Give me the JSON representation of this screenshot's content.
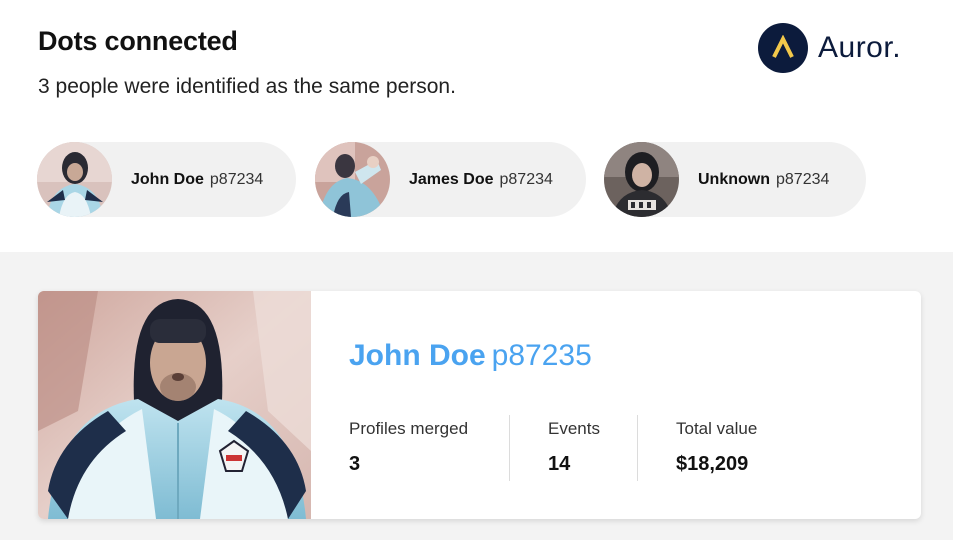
{
  "header": {
    "title": "Dots connected",
    "subtitle": "3 people were identified as the same person."
  },
  "brand": {
    "name": "Auror.",
    "color": "#0c1b3c",
    "accent": "#f2c84b"
  },
  "identified": [
    {
      "name": "John Doe",
      "id": "p87234"
    },
    {
      "name": "James Doe",
      "id": "p87234"
    },
    {
      "name": "Unknown",
      "id": "p87234"
    }
  ],
  "profile": {
    "name": "John Doe",
    "id": "p87235",
    "name_color": "#4aa3f0",
    "stats": [
      {
        "label": "Profiles merged",
        "value": "3"
      },
      {
        "label": "Events",
        "value": "14"
      },
      {
        "label": "Total value",
        "value": "$18,209"
      }
    ]
  }
}
